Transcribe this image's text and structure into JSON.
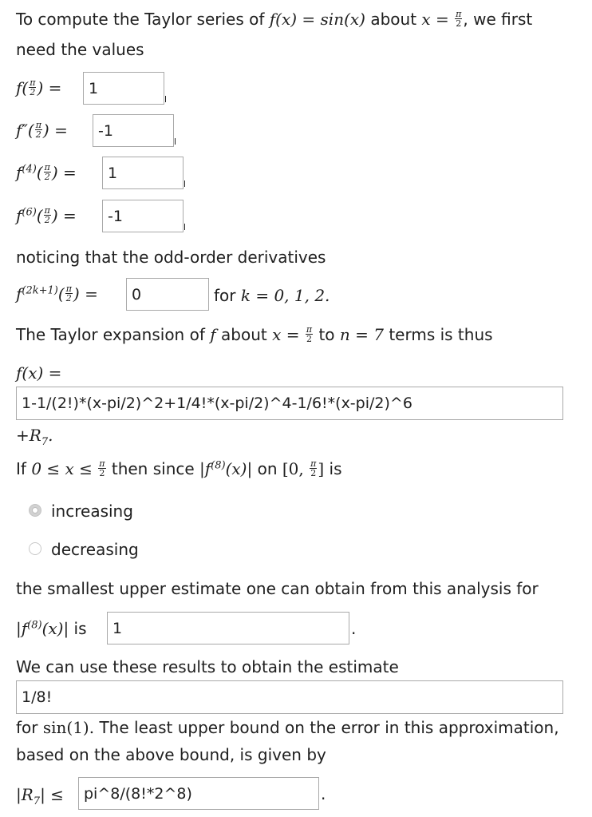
{
  "intro": {
    "line1_a": "To compute the Taylor series of",
    "line1_fx": "f(x) = sin(x)",
    "line1_about": "about",
    "line1_x": "x =",
    "line1_end": ", we first",
    "line2": "need the values"
  },
  "fields": {
    "f_val": "1",
    "f2_val": "-1",
    "f4_val": "1",
    "f6_val": "-1",
    "odd_val": "0",
    "expansion": "1-1/(2!)*(x-pi/2)^2+1/4!*(x-pi/2)^4-1/6!*(x-pi/2)^6",
    "upper_est": "1",
    "estimate": "1/8!",
    "error_bound": "pi^8/(8!*2^8)"
  },
  "labels": {
    "f_label": "f(",
    "f2_label": "f″(",
    "f4_label": "f",
    "f4_sup": "(4)",
    "f6_label": "f",
    "f6_sup": "(6)",
    "eq": ") =",
    "noticing": "noticing that the odd-order derivatives",
    "odd_label": "f",
    "odd_sup": "(2k+1)",
    "for_k_text": "for",
    "for_k_math": "k = 0, 1, 2.",
    "taylor_a": "The Taylor expansion of",
    "taylor_f": "f",
    "taylor_about": "about",
    "taylor_x": "x =",
    "taylor_to": "to",
    "taylor_n": "n = 7",
    "taylor_end": "terms is thus",
    "fx_eq": "f(x) =",
    "plus_r": "+R",
    "plus_r_sub": "7",
    "if_text": "If",
    "if_math": "0 ≤ x ≤",
    "then_text": "then since",
    "abs_f8": "|f",
    "sup8": "(8)",
    "abs_f8_end": "(x)|",
    "on_text": "on",
    "interval": "[0,",
    "interval_end": "]",
    "is_text": "is",
    "smallest": "the smallest upper estimate one can obtain from this analysis for",
    "is_text2": "is",
    "we_can": "We can use these results to obtain the estimate",
    "for_sin": "for",
    "sin1": "sin(1).",
    "least_a": " The least upper bound on the error in this approximation,",
    "least_b": "based on the above bound, is given by",
    "r7": "|R",
    "r7_sub": "7",
    "r7_end": "| ≤",
    "pi_num": "π",
    "two_den": "2"
  },
  "options": [
    {
      "label": "increasing",
      "selected": true
    },
    {
      "label": "decreasing",
      "selected": false
    }
  ]
}
